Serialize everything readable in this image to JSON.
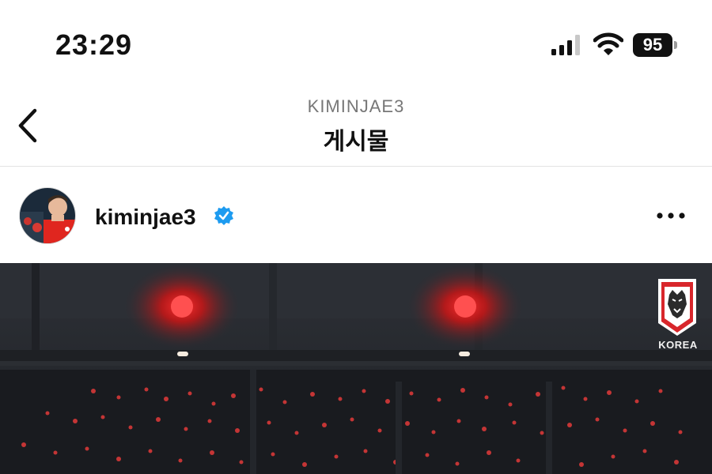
{
  "status_bar": {
    "time": "23:29",
    "battery": "95",
    "icons": [
      "signal-icon",
      "wifi-icon",
      "battery-icon"
    ]
  },
  "header": {
    "account": "KIMINJAE3",
    "title": "게시물",
    "back_icon": "chevron-left-icon"
  },
  "post": {
    "username": "kiminjae3",
    "verified": true,
    "more_icon": "ellipsis-icon",
    "image": {
      "badge_label": "KOREA",
      "accent_color": "#ff2a2a"
    }
  }
}
